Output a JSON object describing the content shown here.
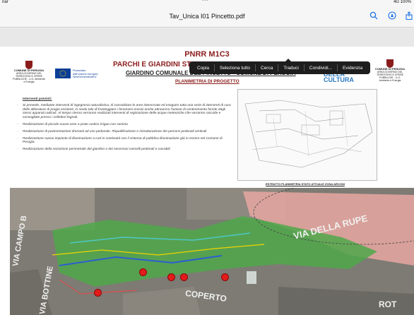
{
  "status_bar": {
    "left": "nar",
    "center": "•••",
    "right": "4G 100%"
  },
  "toolbar": {
    "title": "Tav_Unica I01 Pincetto.pdf",
    "icons": [
      "search-icon",
      "markup-icon",
      "share-icon"
    ]
  },
  "context_menu": {
    "items": [
      "Copia",
      "Seleziona tutto",
      "Cerca",
      "Traduci",
      "Condividi...",
      "Evidenzia"
    ]
  },
  "document": {
    "pnrr": "PNRR M1C3",
    "parchi": "PARCHI E GIARDINI STO",
    "giardino": "GIARDINO COMUNALE DEL PINCETTO - COMUNE DI PERUGIA",
    "planimetria": "PLANIMETRIA DI PROGETTO",
    "logo_left": {
      "name": "COMUNE DI PERUGIA",
      "sub": "AREA GOVERNO DEL TERRITORIO E OPERE PUBBLICHE - U.O. Ambiente e Energia"
    },
    "eu_logo": {
      "line1": "Finanziato",
      "line2": "dall'Unione europea",
      "line3": "NextGenerationEU"
    },
    "cultura_logo": {
      "line1": "DELLA",
      "line2": "CULTURA"
    },
    "logo_right": {
      "name": "COMUNE DI PERUGIA",
      "sub": "AREA GOVERNO DEL TERRITORIO E OPERE PUBBLICHE - U.O. Ambiente e Energia"
    },
    "interventi_heading": "Interventi previsti:",
    "interventi": [
      "Si prevede, mediante interventi di ingegneria naturalistica, di consolidare le aree interessate ed eseguire tutta una serie di interventi di cura delle alberature di pregio esistenti, in modo tale di fronteggiare i fenomeni erosivi anche attraverso l'azione di contenimento fornito dagli stessi apparati radicali. Al tempo stesso verranno realizzati interventi di regimazione delle acque meteoriche che verranno raccolte e convogliate presso i collettori fognali.",
      "Realizzazione di piccole nuove aree a prato rustico irriguo con semina",
      "Realizzazione di pavimentazioni drenanti ad uso pedonale. Riqualificazione e ristrutturazione dei percorsi pedonali verticali",
      "Realizzazione nuovo impianto di illuminazione a Led in continuità con il sistema di pubblica illuminazione già in essere nel Comune di Perugia.",
      "Realizzazione della recinzione perimetrale del giardino e dei necessari cancelli pedonali e carrabili."
    ],
    "estratto": "ESTRATTO PLANIMETRIA STATO ATTUALE ZONA ARCONI",
    "map_labels": {
      "via_della_rupe": "VIA DELLA RUPE",
      "via_campo": "VIA CAMPO B",
      "via_bottine": "VIA BOTTINE",
      "coperto": "COPERTO",
      "rot": "ROT"
    }
  }
}
